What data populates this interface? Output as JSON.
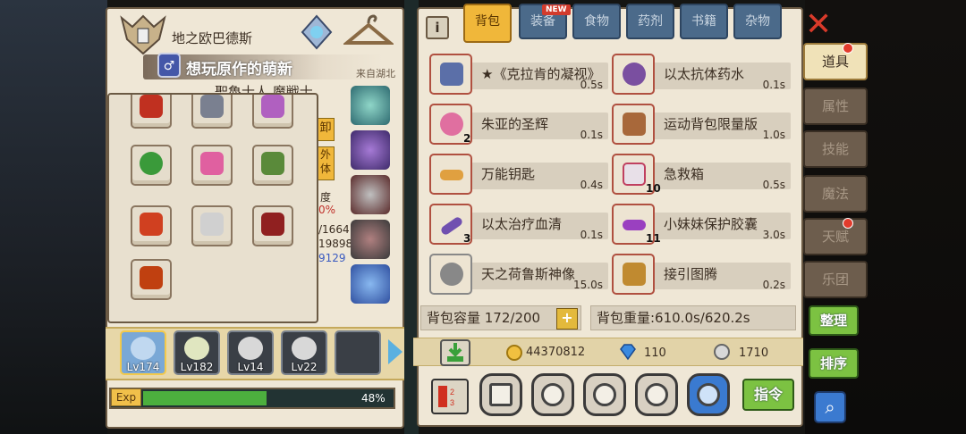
{
  "hero": {
    "title": "地之欧巴德斯",
    "player_name": "想玩原作的萌新",
    "player_badge": "♂",
    "location": "来自湖北",
    "class_text": "聖魯士人 魔戦士"
  },
  "stats_partial": {
    "btn1": "卸",
    "btn2": "外体",
    "t1": "度",
    "t2": "0%",
    "t3": "/1664",
    "t4": "19898",
    "t5": "9129"
  },
  "characters": [
    {
      "level": "Lv174",
      "selected": true
    },
    {
      "level": "Lv182",
      "selected": false
    },
    {
      "level": "Lv14",
      "selected": false
    },
    {
      "level": "Lv22",
      "selected": false
    },
    {
      "level": "",
      "selected": false
    }
  ],
  "exp": {
    "label": "Exp",
    "percent_text": "48%",
    "fraction": 0.48
  },
  "tabs": [
    {
      "label": "背包",
      "active": true
    },
    {
      "label": "装备",
      "active": false,
      "badge": "NEW"
    },
    {
      "label": "食物",
      "active": false
    },
    {
      "label": "药剂",
      "active": false
    },
    {
      "label": "书籍",
      "active": false
    },
    {
      "label": "杂物",
      "active": false
    }
  ],
  "info_label": "i",
  "items": [
    {
      "name": "★《克拉肯的凝视》",
      "weight": "0.5s",
      "count": "",
      "color": "#5b6fa8"
    },
    {
      "name": "以太抗体药水",
      "weight": "0.1s",
      "count": "",
      "color": "#7a4fa0"
    },
    {
      "name": "朱亚的圣辉",
      "weight": "0.1s",
      "count": "2",
      "color": "#e06fa0"
    },
    {
      "name": "运动背包限量版",
      "weight": "1.0s",
      "count": "",
      "color": "#a8683a"
    },
    {
      "name": "万能钥匙",
      "weight": "0.4s",
      "count": "",
      "color": "#e0a040"
    },
    {
      "name": "急救箱",
      "weight": "0.5s",
      "count": "10",
      "color": "#e8e0e8"
    },
    {
      "name": "以太治疗血清",
      "weight": "0.1s",
      "count": "3",
      "color": "#7050b0"
    },
    {
      "name": "小妹妹保护胶囊",
      "weight": "3.0s",
      "count": "11",
      "color": "#9a40c0"
    },
    {
      "name": "天之荷鲁斯神像",
      "weight": "15.0s",
      "count": "",
      "color": "#888888"
    },
    {
      "name": "接引图腾",
      "weight": "0.2s",
      "count": "",
      "color": "#c08a30"
    }
  ],
  "capacity": {
    "text": "背包容量 172/200",
    "plus": "+"
  },
  "weight": {
    "text": "背包重量:610.0s/620.2s"
  },
  "currency": {
    "gold": "44370812",
    "diamond": "110",
    "silver": "1710"
  },
  "command_label": "指令",
  "side_tabs": [
    {
      "label": "道具",
      "active": true,
      "dot": true
    },
    {
      "label": "属性",
      "active": false,
      "dot": false
    },
    {
      "label": "技能",
      "active": false,
      "dot": false
    },
    {
      "label": "魔法",
      "active": false,
      "dot": false
    },
    {
      "label": "天赋",
      "active": false,
      "dot": true
    },
    {
      "label": "乐团",
      "active": false,
      "dot": false
    }
  ],
  "close_label": "✕",
  "sort_label": "整理",
  "order_label": "排序",
  "search_icon": "⌕",
  "colors": {
    "accent_green": "#7cc242",
    "tab_active": "#f0b73a",
    "tab_inactive": "#4b6a8a",
    "close_red": "#d93a2a"
  }
}
